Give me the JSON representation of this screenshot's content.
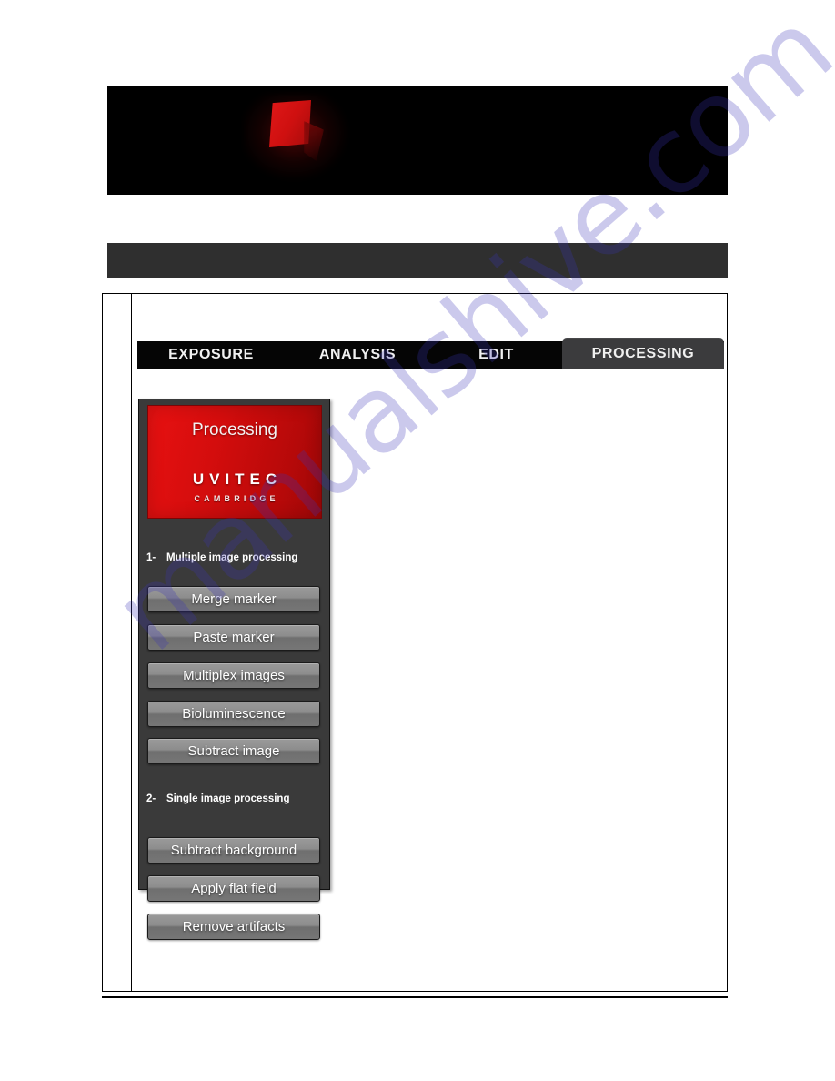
{
  "watermark": {
    "text": "manualshive.com",
    "color": "#3a33b8"
  },
  "banner": {
    "logo_icon": "uvitec-red-square-logo"
  },
  "app": {
    "tabs": [
      {
        "label": "EXPOSURE",
        "active": false
      },
      {
        "label": "ANALYSIS",
        "active": false
      },
      {
        "label": "EDIT",
        "active": false
      },
      {
        "label": "PROCESSING",
        "active": true
      }
    ],
    "panel": {
      "logo": {
        "title": "Processing",
        "brand": "UVITEC",
        "subtitle": "CAMBRIDGE",
        "background_color": "#d40d0d"
      },
      "sections": [
        {
          "number": "1-",
          "title": "Multiple image processing",
          "buttons": [
            "Merge marker",
            "Paste marker",
            "Multiplex images",
            "Bioluminescence",
            "Subtract image"
          ]
        },
        {
          "number": "2-",
          "title": "Single image processing",
          "buttons": [
            "Subtract background",
            "Apply flat field",
            "Remove artifacts"
          ]
        }
      ]
    }
  }
}
